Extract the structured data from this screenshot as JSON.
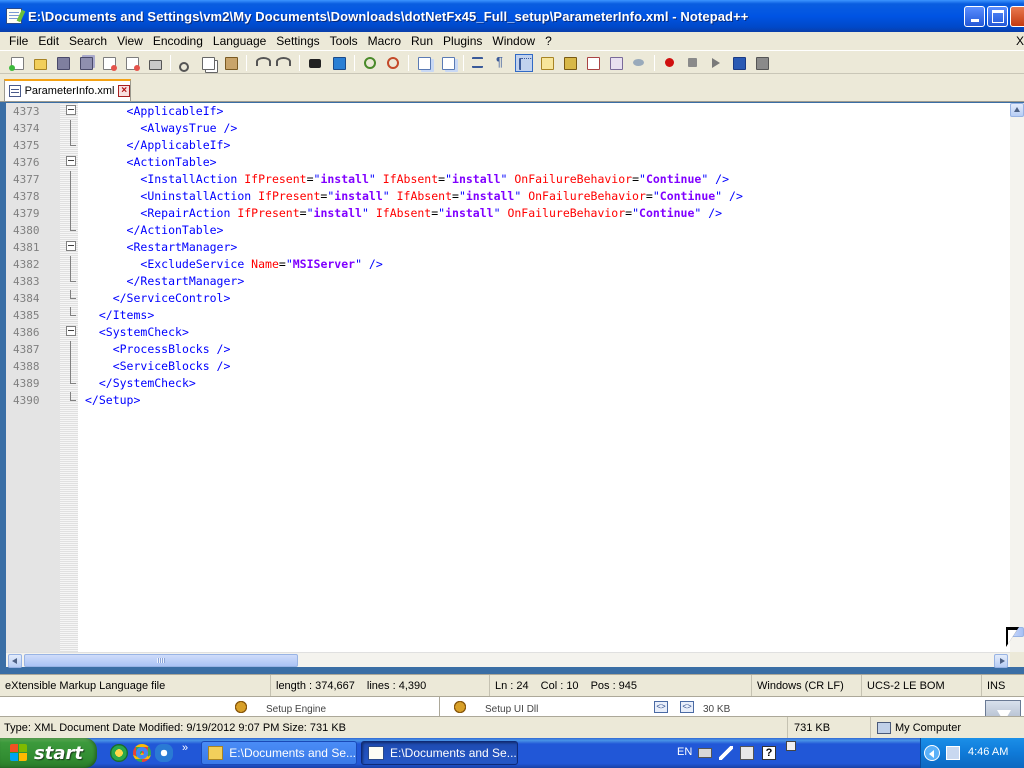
{
  "window": {
    "title": "E:\\Documents and Settings\\vm2\\My Documents\\Downloads\\dotNetFx45_Full_setup\\ParameterInfo.xml - Notepad++"
  },
  "menu": {
    "items": [
      "File",
      "Edit",
      "Search",
      "View",
      "Encoding",
      "Language",
      "Settings",
      "Tools",
      "Macro",
      "Run",
      "Plugins",
      "Window",
      "?"
    ],
    "close_glyph": "X"
  },
  "toolbar": {
    "icons": [
      "new-file-icon",
      "open-file-icon",
      "save-icon",
      "save-all-icon",
      "close-icon",
      "close-all-icon",
      "print-icon",
      "cut-icon",
      "copy-icon",
      "paste-icon",
      "undo-icon",
      "redo-icon",
      "find-icon",
      "replace-icon",
      "zoom-in-icon",
      "zoom-out-icon",
      "sync-vertical-icon",
      "sync-horizontal-icon",
      "word-wrap-icon",
      "show-all-characters-icon",
      "indent-guide-icon",
      "user-defined-language-icon",
      "document-map-icon",
      "function-list-icon",
      "folder-as-workspace-icon",
      "monitoring-icon",
      "record-macro-icon",
      "stop-recording-icon",
      "playback-macro-icon",
      "run-macro-multiple-icon",
      "save-macro-icon"
    ]
  },
  "tabs": [
    {
      "label": "ParameterInfo.xml",
      "active": true
    }
  ],
  "editor": {
    "lines": [
      {
        "num": "4373",
        "fold": "box",
        "indent": 6,
        "tokens": [
          {
            "t": "tag",
            "s": "<ApplicableIf>"
          }
        ]
      },
      {
        "num": "4374",
        "fold": "vline",
        "indent": 8,
        "tokens": [
          {
            "t": "tag",
            "s": "<AlwaysTrue />"
          }
        ]
      },
      {
        "num": "4375",
        "fold": "end",
        "indent": 6,
        "tokens": [
          {
            "t": "tag",
            "s": "</ApplicableIf>"
          }
        ]
      },
      {
        "num": "4376",
        "fold": "box",
        "indent": 6,
        "tokens": [
          {
            "t": "tag",
            "s": "<ActionTable>"
          }
        ]
      },
      {
        "num": "4377",
        "fold": "vline",
        "indent": 8,
        "tokens": [
          {
            "t": "tag",
            "s": "<InstallAction "
          },
          {
            "t": "attr",
            "s": "IfPresent"
          },
          {
            "t": "eq",
            "s": "="
          },
          {
            "t": "tag",
            "s": "\""
          },
          {
            "t": "val",
            "s": "install"
          },
          {
            "t": "tag",
            "s": "\" "
          },
          {
            "t": "attr",
            "s": "IfAbsent"
          },
          {
            "t": "eq",
            "s": "="
          },
          {
            "t": "tag",
            "s": "\""
          },
          {
            "t": "val",
            "s": "install"
          },
          {
            "t": "tag",
            "s": "\" "
          },
          {
            "t": "attr",
            "s": "OnFailureBehavior"
          },
          {
            "t": "eq",
            "s": "="
          },
          {
            "t": "tag",
            "s": "\""
          },
          {
            "t": "val",
            "s": "Continue"
          },
          {
            "t": "tag",
            "s": "\" />"
          }
        ]
      },
      {
        "num": "4378",
        "fold": "vline",
        "indent": 8,
        "tokens": [
          {
            "t": "tag",
            "s": "<UninstallAction "
          },
          {
            "t": "attr",
            "s": "IfPresent"
          },
          {
            "t": "eq",
            "s": "="
          },
          {
            "t": "tag",
            "s": "\""
          },
          {
            "t": "val",
            "s": "install"
          },
          {
            "t": "tag",
            "s": "\" "
          },
          {
            "t": "attr",
            "s": "IfAbsent"
          },
          {
            "t": "eq",
            "s": "="
          },
          {
            "t": "tag",
            "s": "\""
          },
          {
            "t": "val",
            "s": "install"
          },
          {
            "t": "tag",
            "s": "\" "
          },
          {
            "t": "attr",
            "s": "OnFailureBehavior"
          },
          {
            "t": "eq",
            "s": "="
          },
          {
            "t": "tag",
            "s": "\""
          },
          {
            "t": "val",
            "s": "Continue"
          },
          {
            "t": "tag",
            "s": "\" />"
          }
        ]
      },
      {
        "num": "4379",
        "fold": "vline",
        "indent": 8,
        "tokens": [
          {
            "t": "tag",
            "s": "<RepairAction "
          },
          {
            "t": "attr",
            "s": "IfPresent"
          },
          {
            "t": "eq",
            "s": "="
          },
          {
            "t": "tag",
            "s": "\""
          },
          {
            "t": "val",
            "s": "install"
          },
          {
            "t": "tag",
            "s": "\" "
          },
          {
            "t": "attr",
            "s": "IfAbsent"
          },
          {
            "t": "eq",
            "s": "="
          },
          {
            "t": "tag",
            "s": "\""
          },
          {
            "t": "val",
            "s": "install"
          },
          {
            "t": "tag",
            "s": "\" "
          },
          {
            "t": "attr",
            "s": "OnFailureBehavior"
          },
          {
            "t": "eq",
            "s": "="
          },
          {
            "t": "tag",
            "s": "\""
          },
          {
            "t": "val",
            "s": "Continue"
          },
          {
            "t": "tag",
            "s": "\" />"
          }
        ]
      },
      {
        "num": "4380",
        "fold": "end",
        "indent": 6,
        "tokens": [
          {
            "t": "tag",
            "s": "</ActionTable>"
          }
        ]
      },
      {
        "num": "4381",
        "fold": "box",
        "indent": 6,
        "tokens": [
          {
            "t": "tag",
            "s": "<RestartManager>"
          }
        ]
      },
      {
        "num": "4382",
        "fold": "vline",
        "indent": 8,
        "tokens": [
          {
            "t": "tag",
            "s": "<ExcludeService "
          },
          {
            "t": "attr",
            "s": "Name"
          },
          {
            "t": "eq",
            "s": "="
          },
          {
            "t": "tag",
            "s": "\""
          },
          {
            "t": "val",
            "s": "MSIServer"
          },
          {
            "t": "tag",
            "s": "\" />"
          }
        ]
      },
      {
        "num": "4383",
        "fold": "end",
        "indent": 6,
        "tokens": [
          {
            "t": "tag",
            "s": "</RestartManager>"
          }
        ]
      },
      {
        "num": "4384",
        "fold": "end",
        "indent": 4,
        "tokens": [
          {
            "t": "tag",
            "s": "</ServiceControl>"
          }
        ]
      },
      {
        "num": "4385",
        "fold": "end",
        "indent": 2,
        "tokens": [
          {
            "t": "tag",
            "s": "</Items>"
          }
        ]
      },
      {
        "num": "4386",
        "fold": "box",
        "indent": 2,
        "tokens": [
          {
            "t": "tag",
            "s": "<SystemCheck>"
          }
        ]
      },
      {
        "num": "4387",
        "fold": "vline",
        "indent": 4,
        "tokens": [
          {
            "t": "tag",
            "s": "<ProcessBlocks />"
          }
        ]
      },
      {
        "num": "4388",
        "fold": "vline",
        "indent": 4,
        "tokens": [
          {
            "t": "tag",
            "s": "<ServiceBlocks />"
          }
        ]
      },
      {
        "num": "4389",
        "fold": "end",
        "indent": 2,
        "tokens": [
          {
            "t": "tag",
            "s": "</SystemCheck>"
          }
        ]
      },
      {
        "num": "4390",
        "fold": "end",
        "indent": 0,
        "tokens": [
          {
            "t": "tag",
            "s": "</Setup>"
          }
        ]
      }
    ]
  },
  "statusbar": {
    "file_type": "eXtensible Markup Language file",
    "length": "length : 374,667",
    "lines": "lines : 4,390",
    "ln": "Ln : 24",
    "col": "Col : 10",
    "pos": "Pos : 945",
    "eol": "Windows (CR LF)",
    "encoding": "UCS-2 LE BOM",
    "mode": "INS"
  },
  "explorer": {
    "left_item": "Setup Engine",
    "middle_item": "Setup UI Dll",
    "right_item": "30 KB",
    "status_info": "Type: XML Document Date Modified: 9/19/2012 9:07 PM Size: 731 KB",
    "status_size": "731 KB",
    "status_location": "My Computer"
  },
  "taskbar": {
    "start_label": "start",
    "tasks": [
      {
        "label": "E:\\Documents and Se...",
        "active": false
      },
      {
        "label": "E:\\Documents and Se...",
        "active": true
      }
    ],
    "language": "EN",
    "clock": "4:46 AM",
    "quicklaunch_more": "»"
  },
  "colors": {
    "xml_tag": "#0000ff",
    "xml_attr": "#ff0000",
    "xml_value": "#8000ff",
    "titlebar": "#0054e3",
    "taskbar": "#2157d7",
    "start": "#318c31"
  }
}
